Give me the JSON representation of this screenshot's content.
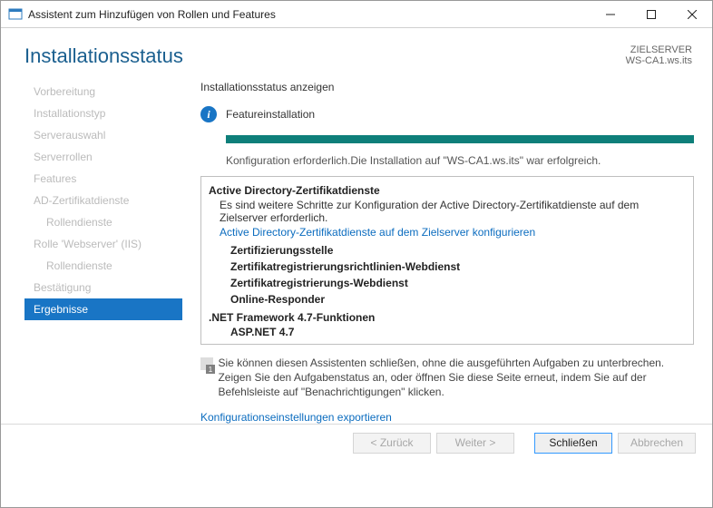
{
  "window": {
    "title": "Assistent zum Hinzufügen von Rollen und Features"
  },
  "header": {
    "title": "Installationsstatus"
  },
  "target": {
    "label": "ZIELSERVER",
    "value": "WS-CA1.ws.its"
  },
  "sidebar": {
    "items": [
      {
        "label": "Vorbereitung"
      },
      {
        "label": "Installationstyp"
      },
      {
        "label": "Serverauswahl"
      },
      {
        "label": "Serverrollen"
      },
      {
        "label": "Features"
      },
      {
        "label": "AD-Zertifikatdienste"
      },
      {
        "label": "Rollendienste"
      },
      {
        "label": "Rolle 'Webserver' (IIS)"
      },
      {
        "label": "Rollendienste"
      },
      {
        "label": "Bestätigung"
      },
      {
        "label": "Ergebnisse"
      }
    ]
  },
  "panel": {
    "heading": "Installationsstatus anzeigen",
    "statusLabel": "Featureinstallation",
    "result": "Konfiguration erforderlich.Die Installation auf \"WS-CA1.ws.its\" war erfolgreich.",
    "list": {
      "group1Title": "Active Directory-Zertifikatdienste",
      "group1Desc": "Es sind weitere Schritte zur Konfiguration der Active Directory-Zertifikatdienste auf dem Zielserver erforderlich.",
      "group1Link": "Active Directory-Zertifikatdienste auf dem Zielserver konfigurieren",
      "items": [
        "Zertifizierungsstelle",
        "Zertifikatregistrierungsrichtlinien-Webdienst",
        "Zertifikatregistrierungs-Webdienst",
        "Online-Responder"
      ],
      "group2Title": ".NET Framework 4.7-Funktionen",
      "group2Item": "ASP.NET 4.7"
    },
    "tipBadge": "1",
    "tipText": "Sie können diesen Assistenten schließen, ohne die ausgeführten Aufgaben zu unterbrechen. Zeigen Sie den Aufgabenstatus an, oder öffnen Sie diese Seite erneut, indem Sie auf der Befehlsleiste auf \"Benachrichtigungen\" klicken.",
    "exportLink": "Konfigurationseinstellungen exportieren"
  },
  "footer": {
    "back": "< Zurück",
    "next": "Weiter >",
    "close": "Schließen",
    "cancel": "Abbrechen"
  }
}
